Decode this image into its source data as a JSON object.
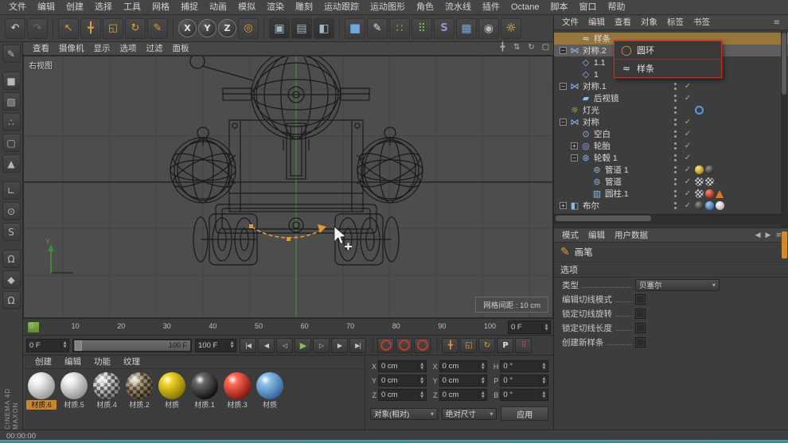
{
  "menubar": {
    "items": [
      "文件",
      "编辑",
      "创建",
      "选择",
      "工具",
      "网格",
      "捕捉",
      "动画",
      "模拟",
      "渲染",
      "雕刻",
      "运动跟踪",
      "运动图形",
      "角色",
      "流水线",
      "插件",
      "Octane",
      "脚本",
      "窗口",
      "帮助"
    ]
  },
  "toolbar": {
    "groups": [
      [
        {
          "name": "undo-icon",
          "glyph": "↶",
          "cls": "tb-plain"
        },
        {
          "name": "redo-icon",
          "glyph": "↷",
          "cls": "tb-dim"
        }
      ],
      [
        {
          "name": "live-selection-icon",
          "glyph": "↖",
          "cls": "tb-orange"
        },
        {
          "name": "move-tool-icon",
          "glyph": "╋",
          "cls": "tb-orange"
        },
        {
          "name": "scale-tool-icon",
          "glyph": "◱",
          "cls": "tb-orange"
        },
        {
          "name": "rotate-tool-icon",
          "glyph": "↻",
          "cls": "tb-orange"
        },
        {
          "name": "brush-tool-icon",
          "glyph": "✎",
          "cls": "tb-orange"
        }
      ],
      [
        {
          "name": "lock-x-button",
          "glyph": "X",
          "cls": "tb-circle"
        },
        {
          "name": "lock-y-button",
          "glyph": "Y",
          "cls": "tb-circle"
        },
        {
          "name": "lock-z-button",
          "glyph": "Z",
          "cls": "tb-circle"
        },
        {
          "name": "coordinate-system-icon",
          "glyph": "◎",
          "cls": "tb-orange"
        }
      ],
      [
        {
          "name": "render-view-icon",
          "glyph": "▣",
          "cls": "tb-render"
        },
        {
          "name": "render-picture-icon",
          "glyph": "▤",
          "cls": "tb-render"
        },
        {
          "name": "render-settings-icon",
          "glyph": "◧",
          "cls": "tb-render"
        }
      ],
      [
        {
          "name": "add-cube-icon",
          "glyph": "■",
          "cls": "tb-blue"
        },
        {
          "name": "spline-pen-icon",
          "glyph": "✎",
          "cls": "tb-pen"
        },
        {
          "name": "array-icon",
          "glyph": "∷",
          "cls": "tb-green"
        },
        {
          "name": "cloner-icon",
          "glyph": "⠿",
          "cls": "tb-green"
        },
        {
          "name": "deformer-icon",
          "glyph": "S",
          "cls": "tb-purple"
        },
        {
          "name": "floor-icon",
          "glyph": "▦",
          "cls": "tb-blue2"
        },
        {
          "name": "camera-icon",
          "glyph": "◉",
          "cls": "tb-dark"
        },
        {
          "name": "light-icon",
          "glyph": "☼",
          "cls": "tb-yellow"
        }
      ]
    ]
  },
  "left_toolbar": {
    "groups": [
      [
        {
          "name": "make-editable-icon",
          "glyph": "✎"
        }
      ],
      [
        {
          "name": "model-mode-icon",
          "glyph": "■"
        },
        {
          "name": "texture-mode-icon",
          "glyph": "▨"
        },
        {
          "name": "points-mode-icon",
          "glyph": "∴"
        },
        {
          "name": "edges-mode-icon",
          "glyph": "▢"
        },
        {
          "name": "polygons-mode-icon",
          "glyph": "▲"
        }
      ],
      [
        {
          "name": "workplane-icon",
          "glyph": "∟"
        },
        {
          "name": "viewport-icon",
          "glyph": "⊙"
        },
        {
          "name": "sds-icon",
          "glyph": "S"
        }
      ],
      [
        {
          "name": "snap-icon",
          "glyph": "Ω"
        },
        {
          "name": "lock-axis-icon",
          "glyph": "◆"
        },
        {
          "name": "magnet-icon",
          "glyph": "Ω"
        }
      ]
    ]
  },
  "viewport": {
    "menu": [
      "查看",
      "摄像机",
      "显示",
      "选项",
      "过滤",
      "面板"
    ],
    "nav_icons": [
      {
        "name": "view-pan-icon",
        "glyph": "╋"
      },
      {
        "name": "view-zoom-icon",
        "glyph": "⇅"
      },
      {
        "name": "view-rotate-icon",
        "glyph": "↻"
      },
      {
        "name": "view-maximize-icon",
        "glyph": "▢"
      }
    ],
    "view_label": "右视图",
    "axis_label": "Y",
    "grid_info": "网格间距 : 10 cm"
  },
  "timeline": {
    "ticks": [
      "0",
      "10",
      "20",
      "30",
      "40",
      "50",
      "60",
      "70",
      "80",
      "90",
      "100"
    ],
    "frame_field": "0 F"
  },
  "transport": {
    "current_frame": "0 F",
    "range_end_label": "100 F",
    "end_frame": "100 F",
    "buttons": [
      {
        "name": "goto-start-button",
        "glyph": "|◀"
      },
      {
        "name": "prev-key-button",
        "glyph": "◀"
      },
      {
        "name": "prev-frame-button",
        "glyph": "◁"
      },
      {
        "name": "play-button",
        "glyph": "▶",
        "cls": "play"
      },
      {
        "name": "next-frame-button",
        "glyph": "▷"
      },
      {
        "name": "next-key-button",
        "glyph": "▶"
      },
      {
        "name": "goto-end-button",
        "glyph": "▶|"
      }
    ],
    "record_buttons": [
      {
        "name": "record-keyframe-button"
      },
      {
        "name": "autokey-button"
      },
      {
        "name": "record-objects-button"
      }
    ],
    "key_buttons": [
      {
        "name": "key-position-button",
        "glyph": "╋",
        "cls": "key"
      },
      {
        "name": "key-scale-button",
        "glyph": "◱",
        "cls": "key"
      },
      {
        "name": "key-rotation-button",
        "glyph": "↻",
        "cls": "key"
      },
      {
        "name": "key-parameter-button",
        "glyph": "P",
        "cls": "keyP"
      },
      {
        "name": "key-selection-button",
        "glyph": "⠿",
        "cls": "keydots"
      }
    ]
  },
  "materials": {
    "menu": [
      "创建",
      "编辑",
      "功能",
      "纹理"
    ],
    "items": [
      {
        "label": "材质.6",
        "hi": "#f2f2f2",
        "lo": "#8f8f8f",
        "cls": "selected",
        "scls": ""
      },
      {
        "label": "材质.5",
        "hi": "#ededed",
        "lo": "#888888",
        "cls": "",
        "scls": ""
      },
      {
        "label": "材质.4",
        "cls": "",
        "scls": "mat-checker"
      },
      {
        "label": "材质.2",
        "cls": "",
        "scls": "mat-checker2"
      },
      {
        "label": "材质",
        "hi": "#f2d62a",
        "lo": "#7c6a00",
        "cls": "",
        "scls": ""
      },
      {
        "label": "材质.1",
        "hi": "#6a6a6a",
        "lo": "#050505",
        "cls": "",
        "scls": ""
      },
      {
        "label": "材质.3",
        "hi": "#ff6a55",
        "lo": "#7e0f08",
        "cls": "",
        "scls": ""
      },
      {
        "label": "材质",
        "hi": "#8fc0ea",
        "lo": "#2a5c95",
        "cls": "",
        "scls": ""
      }
    ]
  },
  "coords": {
    "fields": [
      {
        "l": "X",
        "v": "0 cm"
      },
      {
        "l": "X",
        "v": "0 cm"
      },
      {
        "l": "H",
        "v": "0 °"
      },
      {
        "l": "Y",
        "v": "0 cm"
      },
      {
        "l": "Y",
        "v": "0 cm"
      },
      {
        "l": "P",
        "v": "0 °"
      },
      {
        "l": "Z",
        "v": "0 cm"
      },
      {
        "l": "Z",
        "v": "0 cm"
      },
      {
        "l": "B",
        "v": "0 °"
      }
    ],
    "mode": "对象(相对)",
    "size_mode": "绝对尺寸",
    "apply": "应用"
  },
  "object_manager": {
    "menu": [
      "文件",
      "编辑",
      "查看",
      "对象",
      "标签",
      "书签"
    ],
    "rows": [
      {
        "cls": "ind1 row-drag",
        "exp": "",
        "icon": "≈",
        "icls": "ic-spline",
        "label": "样条",
        "check": "",
        "dotcls": "hide",
        "tags": []
      },
      {
        "cls": "ind0 row-hl",
        "exp": "−",
        "icon": "⋈",
        "icls": "ic-obj",
        "label": "对称.2",
        "check": "",
        "dotcls": "",
        "tags": []
      },
      {
        "cls": "ind1",
        "exp": "",
        "icon": "◇",
        "icls": "ic-obj",
        "label": "1.1",
        "check": "",
        "dotcls": "",
        "tags": []
      },
      {
        "cls": "ind1",
        "exp": "",
        "icon": "◇",
        "icls": "ic-obj",
        "label": "1",
        "check": "",
        "dotcls": "",
        "tags": []
      },
      {
        "cls": "ind0",
        "exp": "−",
        "icon": "⋈",
        "icls": "ic-obj",
        "label": "对称.1",
        "check": "✓",
        "dotcls": "",
        "tags": []
      },
      {
        "cls": "ind1",
        "exp": "",
        "icon": "▰",
        "icls": "ic-obj",
        "label": "后视镜",
        "check": "✓",
        "dotcls": "",
        "tags": []
      },
      {
        "cls": "ind0",
        "exp": "",
        "icon": "☼",
        "icls": "ic-light",
        "label": "灯光",
        "check": "",
        "dotcls": "",
        "tags": [
          "tag-blue-ring"
        ]
      },
      {
        "cls": "ind0",
        "exp": "−",
        "icon": "⋈",
        "icls": "ic-obj",
        "label": "对称",
        "check": "✓",
        "dotcls": "",
        "tags": []
      },
      {
        "cls": "ind1",
        "exp": "",
        "icon": "⊙",
        "icls": "ic-obj",
        "label": "空白",
        "check": "✓",
        "dotcls": "",
        "tags": []
      },
      {
        "cls": "ind1",
        "exp": "+",
        "icon": "◎",
        "icls": "ic-obj",
        "label": "轮胎",
        "check": "✓",
        "dotcls": "",
        "tags": []
      },
      {
        "cls": "ind1",
        "exp": "−",
        "icon": "⊛",
        "icls": "ic-obj",
        "label": "轮毂 1",
        "check": "✓",
        "dotcls": "",
        "tags": []
      },
      {
        "cls": "ind2",
        "exp": "",
        "icon": "⊚",
        "icls": "ic-obj",
        "label": "管道 1",
        "check": "✓",
        "dotcls": "",
        "tags": [
          "tag-sph-yellow",
          "tag-sph-dark"
        ]
      },
      {
        "cls": "ind2",
        "exp": "",
        "icon": "⊚",
        "icls": "ic-obj",
        "label": "管道",
        "check": "✓",
        "dotcls": "",
        "tags": [
          "tag-checker",
          "tag-checker"
        ]
      },
      {
        "cls": "ind2",
        "exp": "",
        "icon": "▥",
        "icls": "ic-obj",
        "label": "圆柱.1",
        "check": "✓",
        "dotcls": "",
        "tags": [
          "tag-checker",
          "tag-sph-red",
          "tag-tri"
        ]
      },
      {
        "cls": "ind0",
        "exp": "+",
        "icon": "◧",
        "icls": "ic-obj",
        "label": "布尔",
        "check": "✓",
        "dotcls": "",
        "tags": [
          "tag-sph-dark",
          "tag-sph-blue",
          "tag-sph-white"
        ]
      }
    ],
    "popup": {
      "items": [
        {
          "icon": "◯",
          "icls": "ic-circle",
          "label": "圆环"
        },
        {
          "icon": "≈",
          "icls": "ic-spline",
          "label": "样条"
        }
      ]
    }
  },
  "attributes": {
    "tabs": [
      "模式",
      "编辑",
      "用户数据"
    ],
    "header_icons": [
      {
        "name": "history-back-icon",
        "glyph": "◀"
      },
      {
        "name": "history-forward-icon",
        "glyph": "▶"
      },
      {
        "name": "am-menu-icon",
        "glyph": "≡"
      }
    ],
    "tool": "画笔",
    "section": "选项",
    "type_label": "类型",
    "type_value": "贝塞尔",
    "options": [
      {
        "label": "编辑切线模式"
      },
      {
        "label": "锁定切线旋转"
      },
      {
        "label": "锁定切线长度"
      },
      {
        "label": "创建新样条"
      }
    ]
  },
  "status": {
    "timecode": "00:00:00"
  },
  "branding": {
    "line1": "MAXON",
    "line2": "CINEMA 4D"
  }
}
